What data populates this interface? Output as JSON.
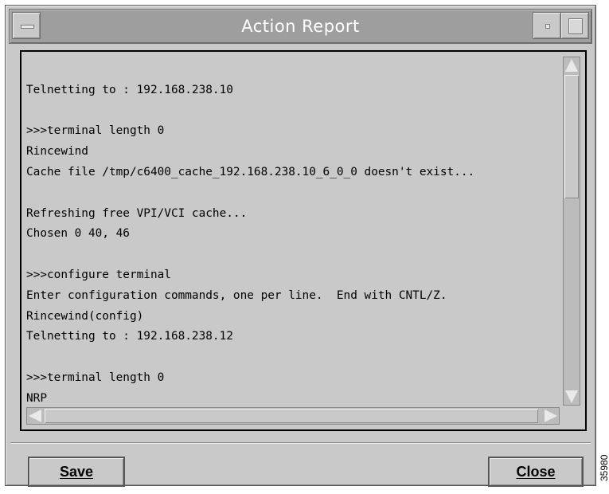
{
  "window": {
    "title": "Action Report",
    "menu_icon": "window-menu-icon",
    "minimize_icon": "window-minimize-icon",
    "maximize_icon": "window-maximize-icon"
  },
  "report": {
    "lines": [
      "",
      "Telnetting to : 192.168.238.10",
      "",
      ">>>terminal length 0",
      "Rincewind",
      "Cache file /tmp/c6400_cache_192.168.238.10_6_0_0 doesn't exist...",
      "",
      "Refreshing free VPI/VCI cache...",
      "Chosen 0 40, 46",
      "",
      ">>>configure terminal",
      "Enter configuration commands, one per line.  End with CNTL/Z.",
      "Rincewind(config)",
      "Telnetting to : 192.168.238.12",
      "",
      ">>>terminal length 0",
      "NRP"
    ]
  },
  "buttons": {
    "save_label": "Save",
    "close_label": "Close"
  },
  "figure_number": "35980"
}
